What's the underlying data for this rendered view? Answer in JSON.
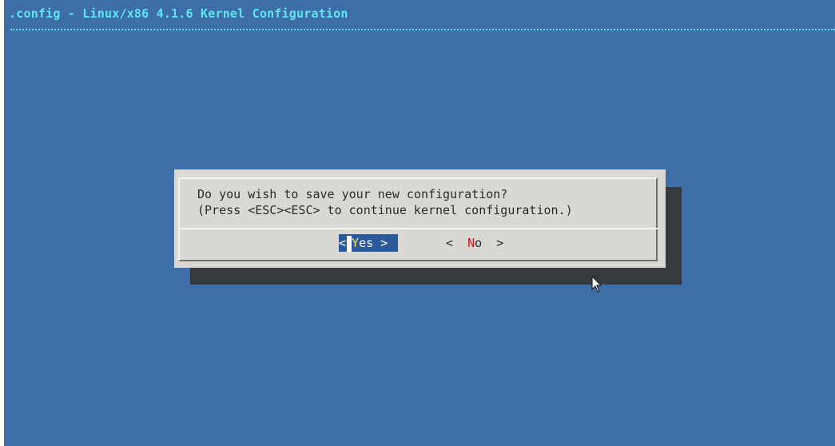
{
  "window": {
    "title": ".config - Linux/x86 4.1.6 Kernel Configuration"
  },
  "dialog": {
    "message_line1": "Do you wish to save your new configuration?",
    "message_line2": "(Press <ESC><ESC> to continue kernel configuration.)",
    "buttons": {
      "yes": {
        "left": "<",
        "hotkey": "Y",
        "rest": "es",
        "right": ">"
      },
      "no": {
        "left": "<",
        "hotkey": "N",
        "rest": "o",
        "right": ">"
      }
    },
    "selected_button": "yes"
  },
  "icons": {
    "mouse_cursor": "arrow-pointer-icon"
  },
  "colors": {
    "background": "#3e6ea8",
    "title": "#5ee6f2",
    "dialog": "#d9d8d2",
    "selected_button_bg": "#2a5a9b",
    "hotkey_selected": "#ffe24a",
    "hotkey_unselected": "#c81e1e"
  }
}
